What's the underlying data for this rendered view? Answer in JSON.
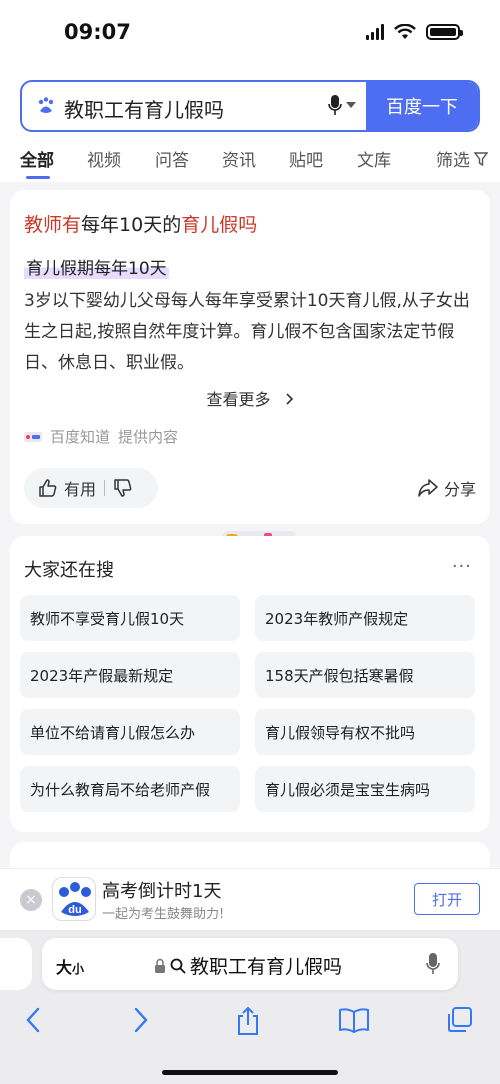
{
  "status": {
    "time": "09:07"
  },
  "search": {
    "query": "教职工有育儿假吗",
    "button": "百度一下"
  },
  "tabs": [
    "全部",
    "视频",
    "问答",
    "资讯",
    "贴吧",
    "文库"
  ],
  "filter": "筛选",
  "result": {
    "title_hl1": "教师有",
    "title_mid": "每年10天的",
    "title_hl2": "育儿假吗",
    "subtitle": "育儿假期每年10天",
    "body": "3岁以下婴幼儿父母每人每年享受累计10天育儿假,从子女出生之日起,按照自然年度计算。育儿假不包含国家法定节假日、休息日、职业假。",
    "more": "查看更多",
    "source": "百度知道",
    "source_note": "提供内容",
    "useful": "有用",
    "share": "分享"
  },
  "related": {
    "title": "大家还在搜",
    "more": "···",
    "items": [
      "教师不享受育儿假10天",
      "2023年教师产假规定",
      "2023年产假最新规定",
      "158天产假包括寒暑假",
      "单位不给请育儿假怎么办",
      "育儿假领导有权不批吗",
      "为什么教育局不给老师产假",
      "育儿假必须是宝宝生病吗"
    ]
  },
  "banner": {
    "close": "×",
    "logo": "du",
    "title": "高考倒计时1天",
    "subtitle": "一起为考生鼓舞助力!",
    "open": "打开"
  },
  "safari": {
    "aa_big": "大",
    "aa_small": "小",
    "address": "教职工有育儿假吗"
  },
  "colors": {
    "accent": "#4e6ef2",
    "highlight": "#c83a2a"
  }
}
